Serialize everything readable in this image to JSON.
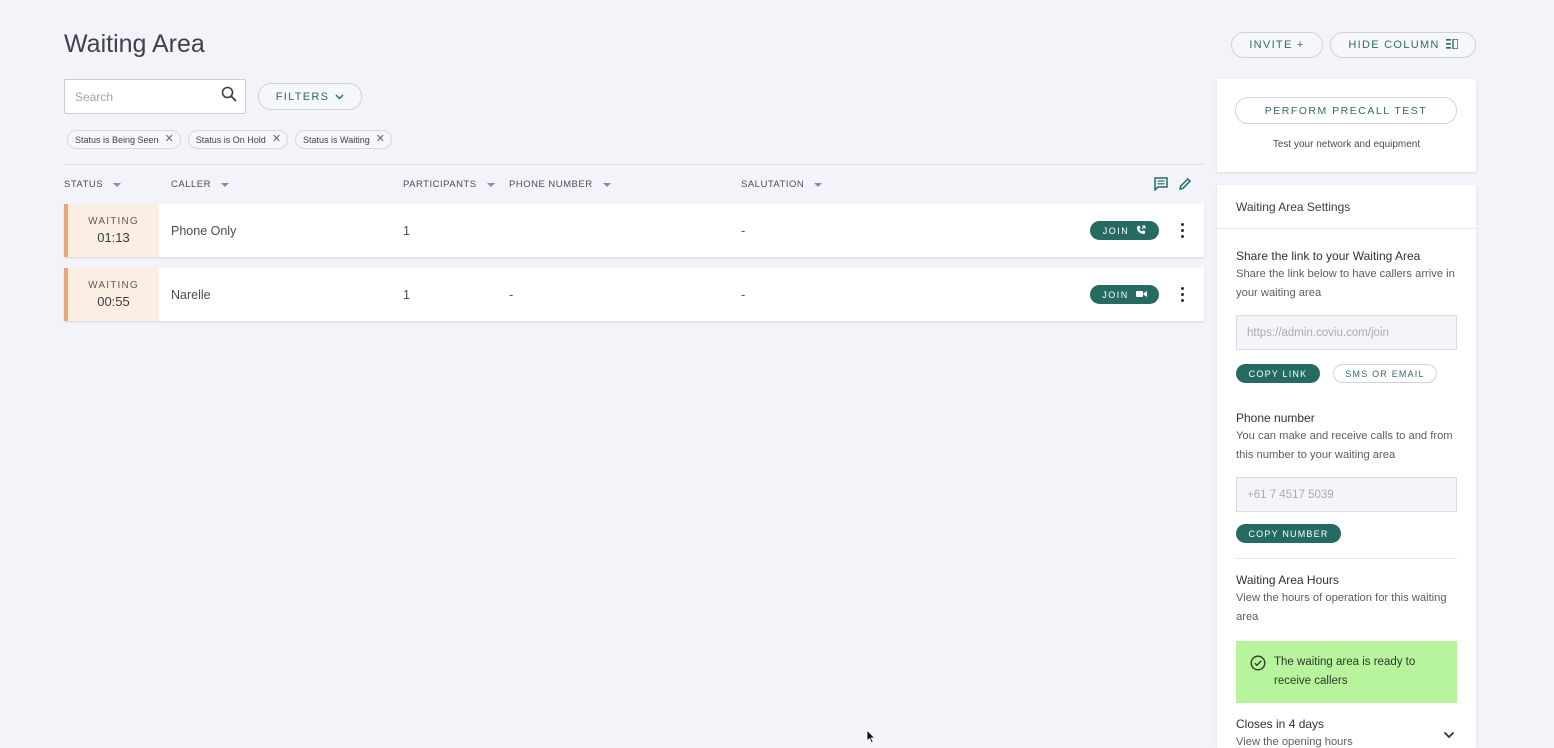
{
  "header": {
    "title": "Waiting Area",
    "invite_label": "INVITE +",
    "hide_column_label": "HIDE COLUMN"
  },
  "search": {
    "placeholder": "Search",
    "value": ""
  },
  "filters": {
    "label": "FILTERS",
    "chips": [
      "Status is Being Seen",
      "Status is On Hold",
      "Status is Waiting"
    ]
  },
  "table": {
    "columns": [
      "STATUS",
      "CALLER",
      "PARTICIPANTS",
      "PHONE NUMBER",
      "SALUTATION"
    ],
    "rows": [
      {
        "status": "WAITING",
        "time": "01:13",
        "caller": "Phone Only",
        "participants": "1",
        "phone": "",
        "salutation": "-",
        "join_label": "JOIN",
        "join_type": "phone"
      },
      {
        "status": "WAITING",
        "time": "00:55",
        "caller": "Narelle",
        "participants": "1",
        "phone": "-",
        "salutation": "-",
        "join_label": "JOIN",
        "join_type": "video"
      }
    ]
  },
  "precall": {
    "button_label": "PERFORM PRECALL TEST",
    "subtitle": "Test your network and equipment"
  },
  "settings": {
    "title": "Waiting Area Settings",
    "share": {
      "title": "Share the link to your Waiting Area",
      "text": "Share the link below to have callers arrive in your waiting area",
      "link": "https://admin.coviu.com/join",
      "copy_label": "COPY LINK",
      "sms_label": "SMS OR EMAIL"
    },
    "phone": {
      "title": "Phone number",
      "text": "You can make and receive calls to and from this number to your waiting area",
      "number": "+61 7 4517 5039",
      "copy_label": "COPY NUMBER"
    },
    "hours": {
      "title": "Waiting Area Hours",
      "text": "View the hours of operation for this waiting area",
      "ready_text": "The waiting area is ready to receive callers",
      "closes_title": "Closes in 4 days",
      "closes_sub": "View the opening hours"
    }
  },
  "colors": {
    "accent": "#256b63",
    "waiting_bg": "#fbeee3",
    "waiting_bar": "#e6a57b",
    "ready_bg": "#b8f49c"
  }
}
